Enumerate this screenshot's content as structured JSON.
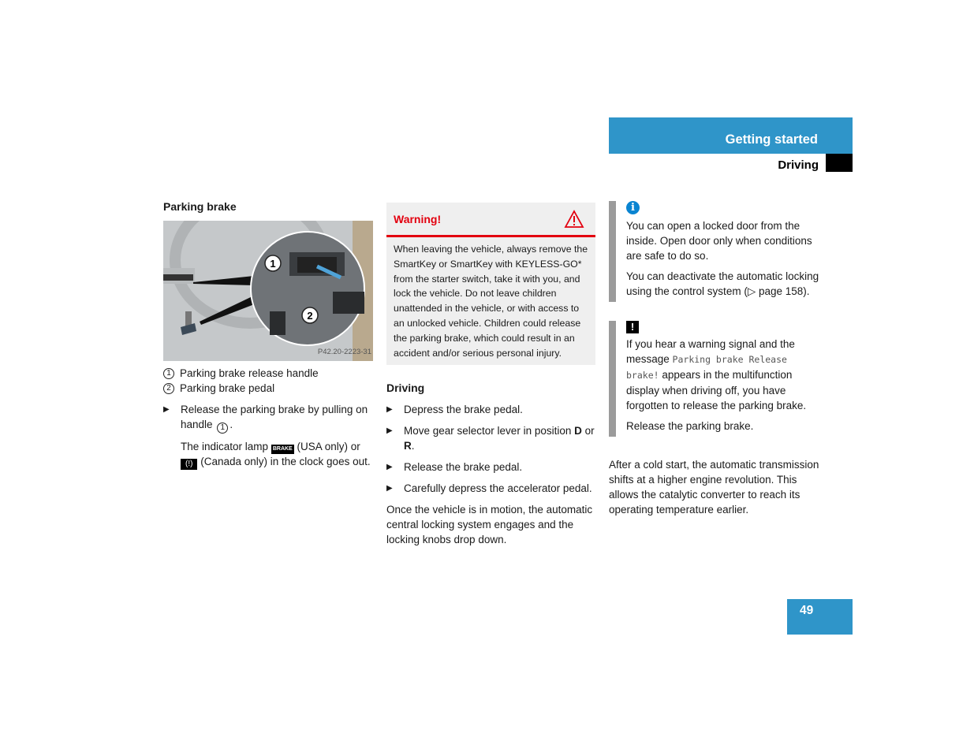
{
  "header": {
    "section": "Getting started",
    "subsection": "Driving",
    "accent_color": "#2f95c9"
  },
  "parking_brake": {
    "heading": "Parking brake",
    "figure_code": "P42.20-2223-31",
    "callouts": [
      "1",
      "2"
    ],
    "legend": [
      {
        "num": "1",
        "text": "Parking brake release handle"
      },
      {
        "num": "2",
        "text": "Parking brake pedal"
      }
    ],
    "step": {
      "before": "Release the parking brake by pulling on handle",
      "num": "1",
      "after": "."
    },
    "indicator": {
      "t1": "The indicator lamp",
      "lamp_usa": "BRAKE",
      "t2": "(USA only) or",
      "lamp_canada": "(!)",
      "t3": "(Canada only) in the clock goes out."
    }
  },
  "warning": {
    "title": "Warning!",
    "color": "#e3000f",
    "body": "When leaving the vehicle, always remove the SmartKey or SmartKey with KEYLESS-GO* from the starter switch, take it with you, and lock the vehicle. Do not leave children unattended in the vehicle, or with access to an unlocked vehicle. Children could release the parking brake, which could result in an accident and/or serious personal injury."
  },
  "driving": {
    "heading": "Driving",
    "steps": [
      {
        "text": "Depress the brake pedal."
      },
      {
        "before": "Move gear selector lever in position",
        "b1": "D",
        "mid": "or",
        "b2": "R",
        "after": "."
      },
      {
        "text": "Release the brake pedal."
      },
      {
        "text": "Carefully depress the accelerator pedal."
      }
    ],
    "tail": "Once the vehicle is in motion, the automatic central locking system engages and the locking knobs drop down."
  },
  "info_note": {
    "icon": "info-icon",
    "p1": "You can open a locked door from the inside. Open door only when conditions are safe to do so.",
    "p2": "You can deactivate the automatic locking using the control system (▷ page 158)."
  },
  "caution_note": {
    "icon": "exclamation-icon",
    "before": "If you hear a warning signal and the message",
    "display_message": "Parking brake Release brake!",
    "after": "appears in the multifunction display when driving off, you have forgotten to release the parking brake.",
    "p2": "Release the parking brake."
  },
  "after_text": "After a cold start, the automatic transmission shifts at a higher engine revolution. This allows the catalytic converter to reach its operating temperature earlier.",
  "page_number": "49"
}
